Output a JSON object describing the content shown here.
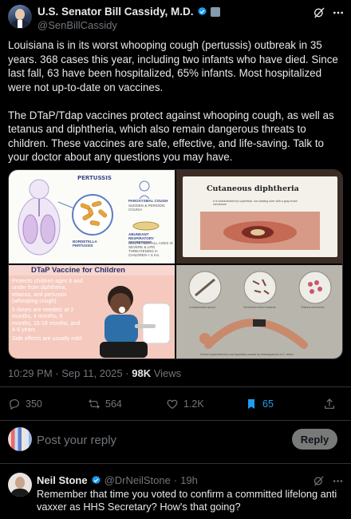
{
  "author": {
    "name": "U.S. Senator Bill Cassidy, M.D.",
    "handle": "@SenBillCassidy"
  },
  "tweet": {
    "paragraph1": "Louisiana is in its worst whooping cough (pertussis) outbreak in 35 years. 368 cases this year, including two infants who have died. Since last fall, 63 have been hospitalized, 65% infants. Most hospitalized were not up-to-date on vaccines.",
    "paragraph2": "The DTaP/Tdap vaccines protect against whooping cough, as well as tetanus and diphtheria, which also remain dangerous threats to children. These vaccines are safe, effective, and life-saving. Talk to your doctor about any questions you may have."
  },
  "media": {
    "panel1": {
      "title": "PERTUSSIS",
      "bacteria_label": "BORDETELLA PERTUSSIS",
      "label2": "PAROXYSMAL COUGH",
      "label2_sub": "SUDDEN & PERIODIC COUGH",
      "label3": "ABUNDANT RESPIRATORY SECRETIONS",
      "label3_sub": "CAN AFFECT ALL AGES IS SEVERE & LIFE THREATENING in CHILDREN < 6 mo"
    },
    "panel2": {
      "title": "Cutaneous diphtheria",
      "caption": "It is characterized by superficial, non-healing ulcer with a gray brown membrane."
    },
    "panel3": {
      "title": "DTaP Vaccine for Children",
      "bullets": [
        "Protects children ages 6 and under from diphtheria, tetanus, and pertussis (whooping cough)",
        "5 doses are needed: at 2 months, 4 months, 6 months, 15-18 months, and 4-6 years",
        "Side effects are usually mild"
      ]
    },
    "panel4": {
      "labels": [
        "Contaminated wound",
        "Clostridium tetani bacteria",
        "Tetanus neurotoxin"
      ],
      "caption": "Severe hyperextension and spasticity caused by tetanospasmin of C. tetani"
    }
  },
  "meta": {
    "time": "10:29 PM",
    "separator": "·",
    "date": "Sep 11, 2025",
    "views_count": "98K",
    "views_label": "Views"
  },
  "actions": {
    "replies": "350",
    "reposts": "564",
    "likes": "1.2K",
    "bookmarks": "65"
  },
  "composer": {
    "placeholder": "Post your reply",
    "button": "Reply"
  },
  "reply": {
    "name": "Neil Stone",
    "handle": "@DrNeilStone",
    "separator": "·",
    "time": "19h",
    "text": "Remember that time you voted to confirm a committed lifelong anti vaxxer as HHS Secretary? How's that going?"
  },
  "colors": {
    "background": "#000000",
    "text": "#e7e9ea",
    "muted": "#71767b",
    "accent": "#1d9bf0",
    "divider": "#2f3336"
  },
  "icons": [
    "verified-icon",
    "government-badge-icon",
    "grok-icon",
    "more-icon",
    "reply-icon",
    "repost-icon",
    "like-icon",
    "bookmark-icon",
    "share-icon"
  ]
}
